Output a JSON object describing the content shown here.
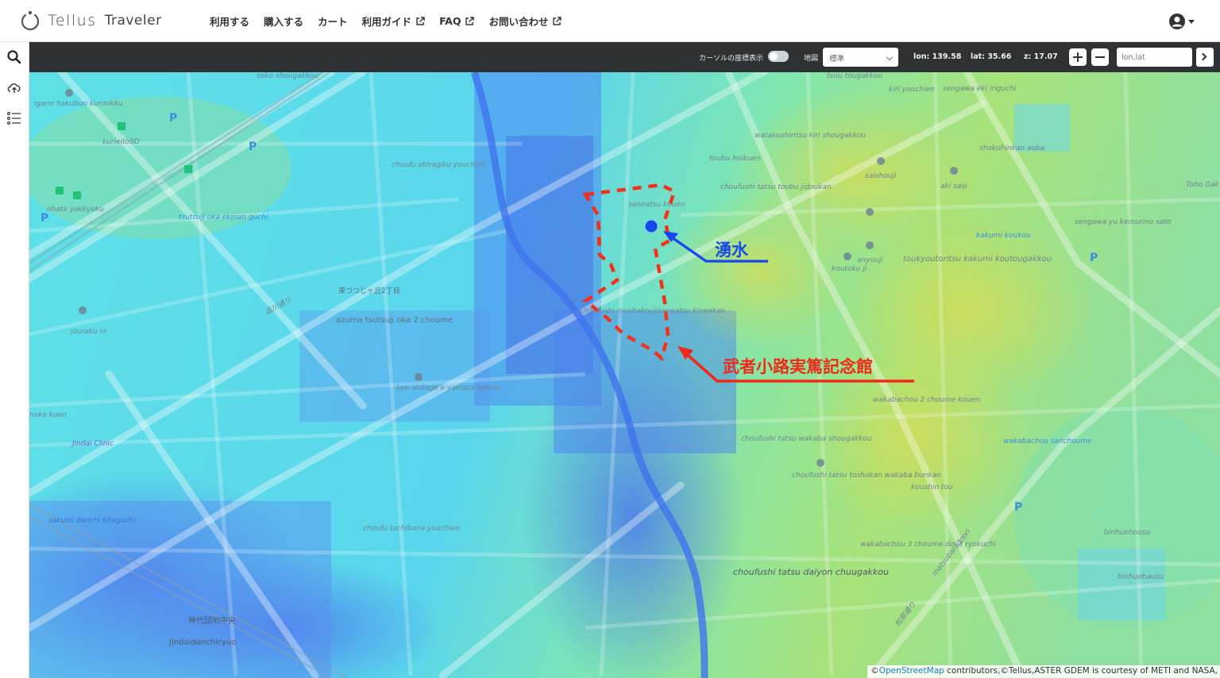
{
  "brand": {
    "name": "Tellus",
    "product": "Traveler"
  },
  "nav": {
    "items": [
      {
        "label": "利用する",
        "external": false
      },
      {
        "label": "購入する",
        "external": false
      },
      {
        "label": "カート",
        "external": false
      },
      {
        "label": "利用ガイド",
        "external": true
      },
      {
        "label": "FAQ",
        "external": true
      },
      {
        "label": "お問い合わせ",
        "external": true
      }
    ]
  },
  "sidebar": {
    "items": [
      "search-icon",
      "cloud-upload-icon",
      "list-icon"
    ]
  },
  "toolbar": {
    "cursor_coord_label": "カーソルの座標表示",
    "cursor_coord_enabled": false,
    "map_label": "地図",
    "map_type": "標準",
    "lon": "lon: 139.58",
    "lat": "lat: 35.66",
    "zoom": "z: 17.07",
    "coord_placeholder": "lon,lat"
  },
  "map": {
    "annotations": {
      "spring": "湧水",
      "memorial": "武者小路実篤記念館"
    },
    "labels": [
      "soko shougakkou",
      "igami hakubun kurinikku",
      "kurieitoSD",
      "obata yakkyoku",
      "tsutsuji oka ekinan guchi",
      "jouraku in",
      "azuma tsutsuji oka 2 choume",
      "東つつじヶ丘2丁目",
      "品川通り",
      "ken shirage e yamata byouin",
      "choufu shiragiku youchien",
      "saneatsu kouen",
      "choufushi mushakoujisaneatsu kinenkan",
      "toubu hoikuen",
      "choufushi tatsu toubu jidoukan",
      "watakushiritsu kiri shougakkou",
      "kiri youchien",
      "sengawa eki iriguchi",
      "saishouji",
      "aki saiji",
      "anyouji",
      "koutoku ji",
      "toukyoutoritsu kakumi koutougakkou",
      "kakumi koukou",
      "shokuhinkan aoba",
      "sengawa yu kemurino sato",
      "Toho Gak School of Mus",
      "tsuu tougakkou",
      "wakabachou 2 choume kouen",
      "choufushi tatsu wakaba shougakkou",
      "choufushi tatsu toshokan wakaba bunkan",
      "koushin tou",
      "wakabachou sanchoume",
      "wakabachou 3 choume doi 3 ryokuchi",
      "matsubaradoori",
      "松原通り",
      "choufushi tatsu daiyon chuugakkou",
      "choufu tachibana youchien",
      "sakumi danchi kitaguchi",
      "Jindai Clinic",
      "neko kuen",
      "神代団地中央",
      "Jindaidanchicyuo",
      "binhuehousu",
      "binhuehausu"
    ]
  },
  "attribution": {
    "prefix": "©",
    "osm": "OpenStreetMap",
    "rest": " contributors,©Tellus,ASTER GDEM is courtesy of METI and NASA,"
  },
  "colors": {
    "toolbar_bg": "#2f3234",
    "annotation_blue": "#1748e8",
    "annotation_red": "#ee2a1a",
    "low_elevation": "#4a7cf0",
    "mid_elevation": "#5fe3e6",
    "high_elevation": "#b3e06a"
  }
}
